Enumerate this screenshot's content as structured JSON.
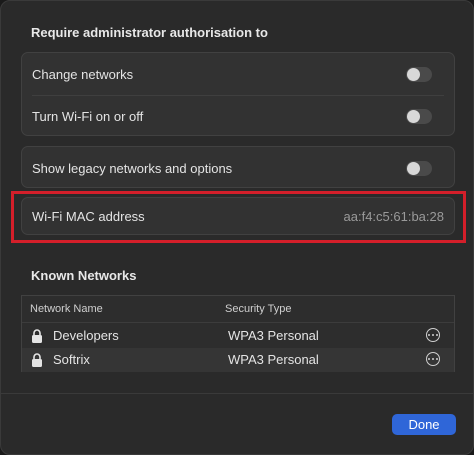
{
  "admin": {
    "title": "Require administrator authorisation to",
    "items": [
      {
        "label": "Change networks",
        "on": false
      },
      {
        "label": "Turn Wi-Fi on or off",
        "on": false
      }
    ]
  },
  "legacy": {
    "label": "Show legacy networks and options",
    "on": false
  },
  "mac": {
    "label": "Wi-Fi MAC address",
    "value": "aa:f4:c5:61:ba:28"
  },
  "known": {
    "title": "Known Networks",
    "columns": {
      "name": "Network Name",
      "security": "Security Type"
    },
    "rows": [
      {
        "name": "Developers",
        "security": "WPA3 Personal"
      },
      {
        "name": "Softrix",
        "security": "WPA3 Personal"
      }
    ]
  },
  "footer": {
    "done_label": "Done"
  },
  "colors": {
    "accent": "#2f66d8",
    "highlight": "#d41f2a"
  }
}
